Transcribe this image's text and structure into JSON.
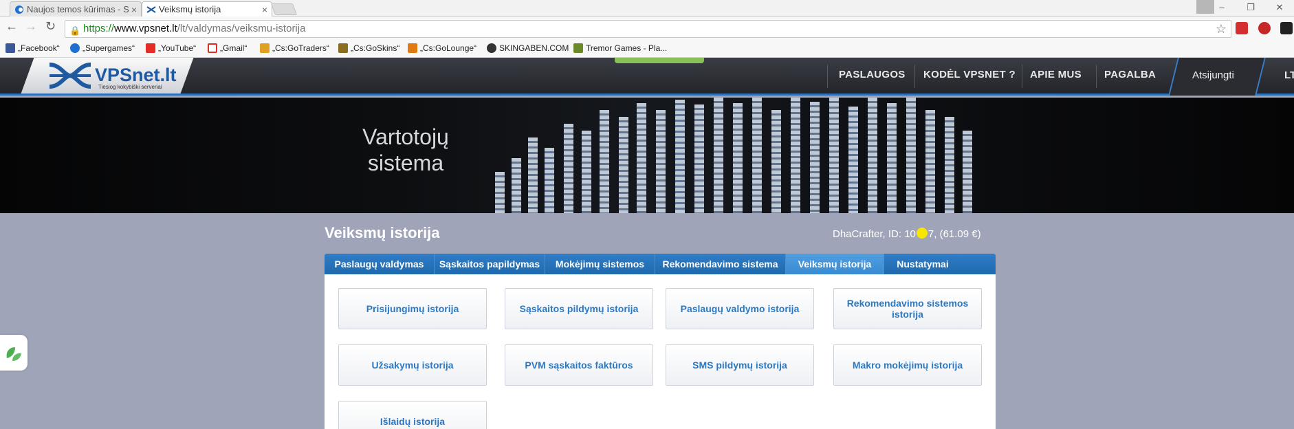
{
  "browser": {
    "tabs": [
      {
        "title": "Naujos temos kūrimas - S",
        "active": false
      },
      {
        "title": "Veiksmų istorija",
        "active": true
      }
    ],
    "url": {
      "scheme": "https://",
      "host": "www.vpsnet.lt",
      "path": "/lt/valdymas/veiksmu-istorija"
    },
    "bookmarks": [
      {
        "label": "„Facebook“",
        "icon": "facebook-icon",
        "color": "#3b5998"
      },
      {
        "label": "„Supergames“",
        "icon": "supergames-icon",
        "color": "#1f6fd1"
      },
      {
        "label": "„YouTube“",
        "icon": "youtube-icon",
        "color": "#e52d27"
      },
      {
        "label": "„Gmail“",
        "icon": "gmail-icon",
        "color": "#d93025"
      },
      {
        "label": "„Cs:GoTraders“",
        "icon": "csgotraders-icon",
        "color": "#e0a020"
      },
      {
        "label": "„Cs:GoSkins“",
        "icon": "csgoskins-icon",
        "color": "#8a6d1f"
      },
      {
        "label": "„Cs:GoLounge“",
        "icon": "csgolounge-icon",
        "color": "#e07a10"
      },
      {
        "label": "SKINGABEN.COM",
        "icon": "steam-icon",
        "color": "#333333"
      },
      {
        "label": "Tremor Games - Pla...",
        "icon": "tremor-icon",
        "color": "#6a8a2a"
      }
    ]
  },
  "site": {
    "logo": {
      "name": "VPSnet.lt",
      "tagline": "Tiesiog kokybiški serveriai"
    },
    "menu": [
      "PASLAUGOS",
      "KODĖL VPSNET ?",
      "APIE MUS",
      "PAGALBA"
    ],
    "logout": "Atsijungti",
    "lang": "LT",
    "hero_title": [
      "Vartotojų",
      "sistema"
    ]
  },
  "main": {
    "title": "Veiksmų istorija",
    "account": {
      "prefix": "DhaCrafter, ID: 10",
      "suffix": "7, (61.09 €)"
    },
    "tabs": [
      "Paslaugų valdymas",
      "Sąskaitos papildymas",
      "Mokėjimų sistemos",
      "Rekomendavimo sistema",
      "Veiksmų istorija",
      "Nustatymai"
    ],
    "active_tab": "Veiksmų istorija",
    "tiles": [
      "Prisijungimų istorija",
      "Sąskaitos pildymų istorija",
      "Paslaugų valdymo istorija",
      "Rekomendavimo sistemos istorija",
      "Užsakymų istorija",
      "PVM sąskaitos faktūros",
      "SMS pildymų istorija",
      "Makro mokėjimų istorija",
      "Išlaidų istorija"
    ]
  },
  "colors": {
    "accent": "#2a79c4",
    "nav_bg": "#2a2c31",
    "page_bg": "#9fa4b8",
    "brand": "#1f5aa0"
  }
}
